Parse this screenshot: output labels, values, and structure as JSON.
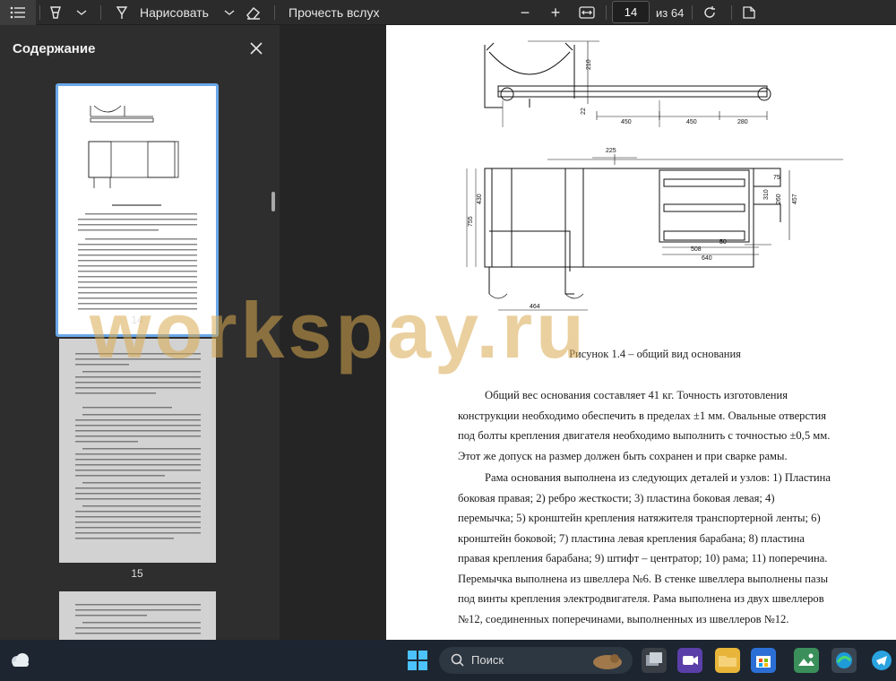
{
  "toolbar": {
    "draw_label": "Нарисовать",
    "read_aloud_label": "Прочесть вслух",
    "zoom_out": "−",
    "zoom_in": "+",
    "current_page": "14",
    "page_total_label": "из 64"
  },
  "sidebar": {
    "title": "Содержание",
    "thumbnails": [
      {
        "page_number": "14",
        "selected": true
      },
      {
        "page_number": "15",
        "selected": false
      }
    ]
  },
  "document": {
    "figure_caption": "Рисунок 1.4 – общий вид основания",
    "paragraph_1_lines": [
      "Общий вес основания  составляет 41 кг. Точность изготовления",
      "конструкции необходимо обеспечить в пределах ±1 мм. Овальные отверстия",
      "под болты крепления двигателя необходимо выполнить с точностью ±0,5 мм.",
      "Этот же допуск на размер должен быть сохранен  и при сварке рамы."
    ],
    "paragraph_2_lines": [
      "Рама основания выполнена из следующих деталей и узлов: 1) Пластина",
      "боковая правая; 2) ребро жесткости; 3)    пластина боковая левая; 4)",
      "перемычка; 5) кронштейн крепления натяжителя транспортерной ленты; 6)",
      "кронштейн боковой; 7) пластина левая крепления барабана; 8) пластина",
      "правая крепления барабана; 9) штифт – центратор; 10) рама; 11)  поперечина.",
      "Перемычка выполнена из швеллера №6. В стенке швеллера выполнены пазы",
      "под винты крепления электродвигателя. Рама выполнена из двух швеллеров",
      "№12, соединенных поперечинами, выполненных из швеллеров №12."
    ],
    "drawing_dimensions": {
      "top_view": [
        "210",
        "22",
        "450",
        "450",
        "280"
      ],
      "bottom_view": [
        "225",
        "75",
        "457",
        "260",
        "310",
        "755",
        "430",
        "50",
        "508",
        "640",
        "464"
      ]
    }
  },
  "watermark": "workspay.ru",
  "taskbar": {
    "search_label": "Поиск"
  },
  "colors": {
    "toolbar_bg": "#2b2b2b",
    "sidebar_bg": "#2e2e2e",
    "selection_border": "#6aa8e8",
    "watermark": "#d8aa50",
    "taskbar_bg": "#1c2530"
  }
}
